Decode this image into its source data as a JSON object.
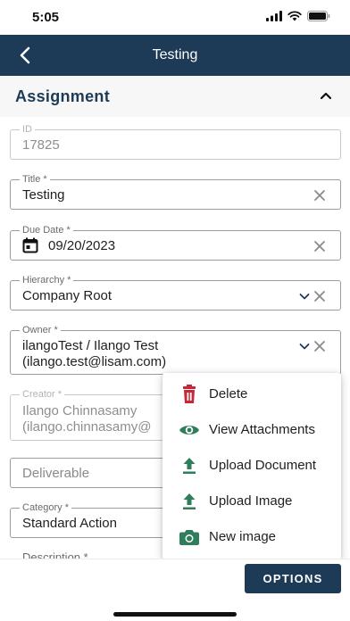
{
  "status_bar": {
    "time": "5:05"
  },
  "nav": {
    "title": "Testing"
  },
  "section": {
    "title": "Assignment"
  },
  "fields": {
    "id": {
      "label": "ID",
      "value": "17825"
    },
    "title": {
      "label": "Title *",
      "value": "Testing"
    },
    "due_date": {
      "label": "Due Date *",
      "value": "09/20/2023"
    },
    "hierarchy": {
      "label": "Hierarchy *",
      "value": "Company Root"
    },
    "owner": {
      "label": "Owner *",
      "value_line1": "ilangoTest /  Ilango Test",
      "value_line2": "(ilango.test@lisam.com)"
    },
    "creator": {
      "label": "Creator *",
      "value_line1": "Ilango Chinnasamy",
      "value_line2": "(ilango.chinnasamy@"
    },
    "deliverable": {
      "placeholder": "Deliverable"
    },
    "category": {
      "label": "Category *",
      "value": "Standard Action"
    },
    "description": {
      "label": "Description *"
    }
  },
  "menu": {
    "items": [
      {
        "label": "Delete",
        "icon": "trash-icon",
        "color": "#c62839"
      },
      {
        "label": "View Attachments",
        "icon": "eye-icon",
        "color": "#2e7d5b"
      },
      {
        "label": "Upload Document",
        "icon": "upload-icon",
        "color": "#2e7d5b"
      },
      {
        "label": "Upload Image",
        "icon": "upload-icon",
        "color": "#2e7d5b"
      },
      {
        "label": "New image",
        "icon": "camera-icon",
        "color": "#2e7d5b"
      }
    ]
  },
  "bottom": {
    "options_label": "OPTIONS"
  },
  "colors": {
    "primary": "#1d3a57",
    "danger": "#c62839",
    "success": "#2e7d5b"
  }
}
